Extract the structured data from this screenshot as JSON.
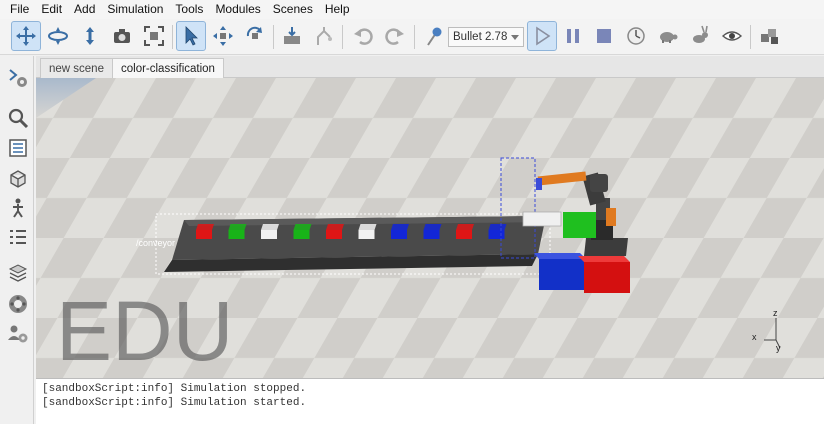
{
  "menu": [
    "File",
    "Edit",
    "Add",
    "Simulation",
    "Tools",
    "Modules",
    "Scenes",
    "Help"
  ],
  "toolbar": {
    "buttons": [
      {
        "name": "camera-pan-icon"
      },
      {
        "name": "camera-rotate-icon"
      },
      {
        "name": "camera-shift-icon"
      },
      {
        "name": "camera-angle-icon"
      },
      {
        "name": "camera-fit-icon"
      },
      {
        "name": "click-select-icon"
      },
      {
        "name": "object-shift-icon"
      },
      {
        "name": "object-rotate-icon"
      },
      {
        "name": "assemble-icon"
      },
      {
        "name": "transfer-dna-icon"
      },
      {
        "name": "undo-icon"
      },
      {
        "name": "redo-icon"
      },
      {
        "name": "dynamics-icon"
      },
      {
        "name": "start-simulation-icon"
      },
      {
        "name": "pause-simulation-icon"
      },
      {
        "name": "stop-simulation-icon"
      },
      {
        "name": "real-time-icon"
      },
      {
        "name": "slow-down-icon"
      },
      {
        "name": "speed-up-icon"
      },
      {
        "name": "visualization-icon"
      },
      {
        "name": "page-selector-icon"
      }
    ],
    "engine": "Bullet 2.78"
  },
  "sidebar": [
    "model-browser-icon",
    "scene-hierarchy-icon",
    "properties-icon",
    "shape-edit-icon",
    "path-edit-icon",
    "layers-icon",
    "selection-icon",
    "collections-icon",
    "scripts-icon",
    "user-settings-icon"
  ],
  "tabs": [
    {
      "label": "new scene",
      "active": false
    },
    {
      "label": "color-classification",
      "active": true
    }
  ],
  "viewport": {
    "watermark": "EDU",
    "conveyor_label": "/conveyor",
    "axis_labels": {
      "x": "x",
      "y": "y",
      "z": "z"
    },
    "cube_colors": [
      "#e01515",
      "#18b418",
      "#f2f2f2",
      "#18b418",
      "#e01515",
      "#f2f2f2",
      "#1226d8",
      "#1226d8",
      "#e01515",
      "#1226d8"
    ],
    "bin_colors": {
      "blue": "#1230c8",
      "red": "#d41010",
      "green": "#1fbf1f",
      "white": "#f0f0f0"
    },
    "robot_color": "#e07a20"
  },
  "console": {
    "lines": [
      "[sandboxScript:info] Simulation stopped.",
      "[sandboxScript:info] Simulation started."
    ]
  }
}
